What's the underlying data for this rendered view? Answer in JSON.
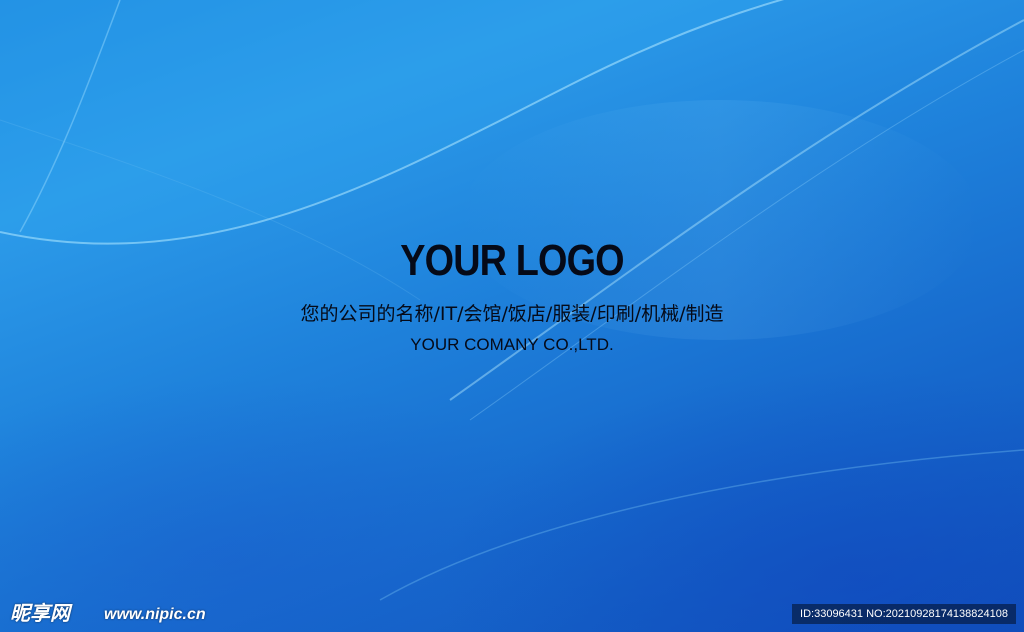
{
  "logo": {
    "title": "YOUR LOGO",
    "subtitle_cn": "您的公司的名称/IT/会馆/饭店/服装/印刷/机械/制造",
    "subtitle_en": "YOUR COMANY CO.,LTD."
  },
  "watermark": {
    "site_name": "昵享网",
    "url": "www.nipic.cn",
    "id_text": "ID:33096431 NO:20210928174138824108"
  },
  "colors": {
    "background_primary": "#1f83dc",
    "background_dark": "#1050bb",
    "text": "#050a18"
  }
}
